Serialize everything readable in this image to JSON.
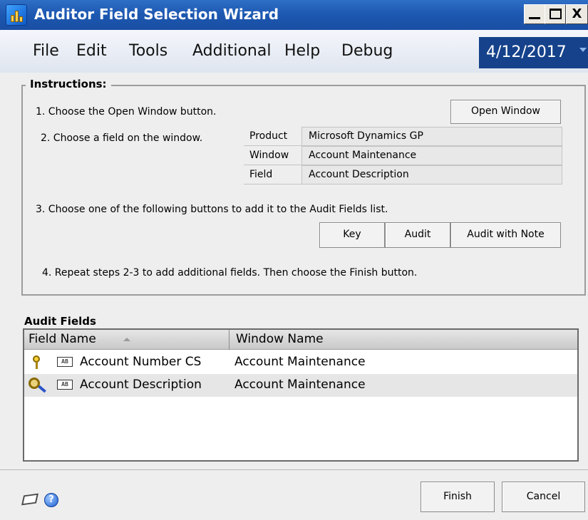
{
  "window": {
    "title": "Auditor Field Selection Wizard",
    "buttons": {
      "minimize": "_",
      "maximize": "□",
      "close": "X"
    }
  },
  "menu": {
    "items": [
      "File",
      "Edit",
      "Tools",
      "Additional",
      "Help",
      "Debug"
    ],
    "date": "4/12/2017"
  },
  "instructions": {
    "legend": "Instructions:",
    "step1": "1. Choose the Open Window button.",
    "step2": "2. Choose a field on the window.",
    "step3": "3. Choose one of the following buttons to add it to the Audit Fields list.",
    "step4": "4. Repeat steps 2-3 to add additional fields.  Then choose the Finish button.",
    "open_window_button": "Open Window",
    "info": [
      {
        "label": "Product",
        "value": "Microsoft Dynamics GP"
      },
      {
        "label": "Window",
        "value": "Account Maintenance"
      },
      {
        "label": "Field",
        "value": "Account Description"
      }
    ],
    "key_button": "Key",
    "audit_button": "Audit",
    "audit_note_button": "Audit with Note"
  },
  "audit_fields": {
    "title": "Audit Fields",
    "columns": [
      "Field Name",
      "Window Name"
    ],
    "rows": [
      {
        "icon": "key-icon",
        "field_name": "Account Number CS",
        "window_name": "Account Maintenance"
      },
      {
        "icon": "audit-magnifier-icon",
        "field_name": "Account Description",
        "window_name": "Account Maintenance"
      }
    ],
    "field_badge": "AB"
  },
  "footer": {
    "finish_button": "Finish",
    "cancel_button": "Cancel",
    "help_glyph": "?"
  }
}
